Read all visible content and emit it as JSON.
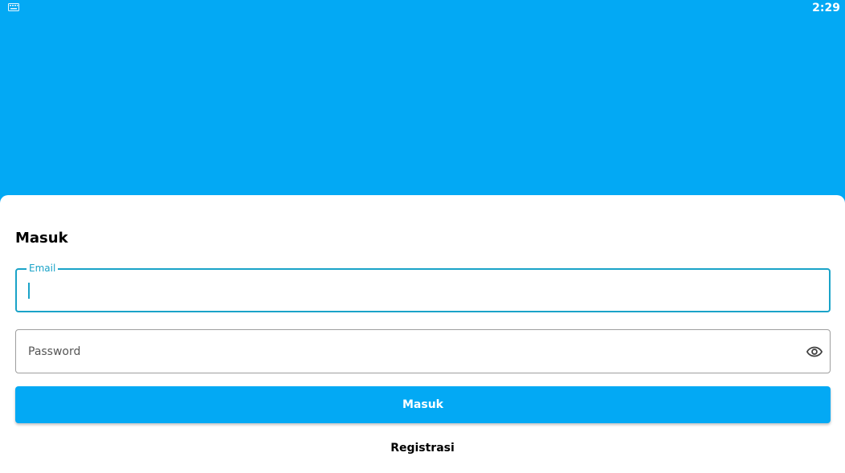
{
  "status_bar": {
    "time": "2:29",
    "keyboard_icon": "keyboard-icon"
  },
  "login": {
    "title": "Masuk",
    "email": {
      "label": "Email",
      "value": ""
    },
    "password": {
      "placeholder": "Password",
      "value": "",
      "visibility_icon": "eye-icon"
    },
    "submit_label": "Masuk",
    "register_label": "Registrasi"
  },
  "colors": {
    "primary": "#03A9F4",
    "focus_border": "#1aa3c8",
    "surface": "#ffffff"
  }
}
